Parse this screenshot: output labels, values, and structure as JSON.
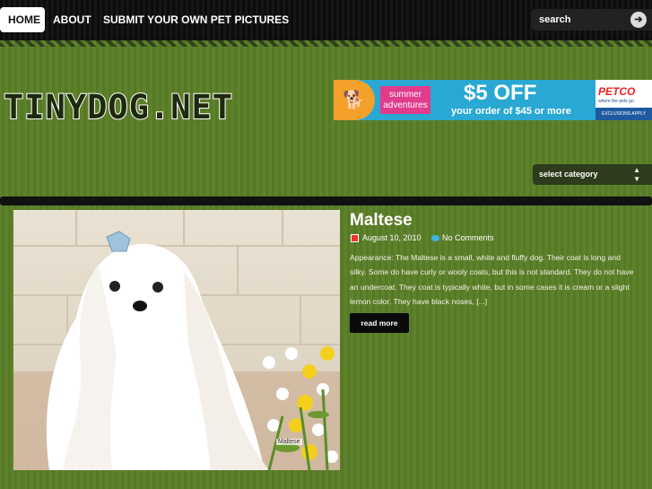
{
  "nav": {
    "items": [
      {
        "label": "HOME",
        "active": true
      },
      {
        "label": "ABOUT",
        "active": false
      },
      {
        "label": "SUBMIT YOUR OWN PET PICTURES",
        "active": false
      }
    ]
  },
  "search": {
    "placeholder": "search",
    "button_icon": "arrow-right-icon"
  },
  "site": {
    "logo": "TINYDOG.NET"
  },
  "ad": {
    "summer": "summer adventures",
    "headline": "$5 OFF",
    "subline": "your order of $45 or more",
    "brand": "PETCO",
    "tagline": "where the pets go",
    "note": "EXCLUSIONS APPLY"
  },
  "category_select": {
    "selected": "select category"
  },
  "post": {
    "title": "Maltese",
    "date": "August 10, 2010",
    "comments": "No Comments",
    "excerpt": "Appearance:  The Maltese is a small, white and fluffy dog. Their coat is long and silky. Some do have curly or wooly coats, but this is not standard. They do not have an undercoat. They coat is typically white, but in some cases it is cream or a slight lemon color. They have black noses, [...]",
    "read_more": "read more",
    "image_caption": "Maltese"
  },
  "colors": {
    "background": "#5a7e26",
    "topbar": "#111111",
    "ad_blue": "#29a8d4",
    "ad_orange": "#f4a12c",
    "ad_pink": "#e13b8c",
    "petco_red": "#e22222"
  }
}
